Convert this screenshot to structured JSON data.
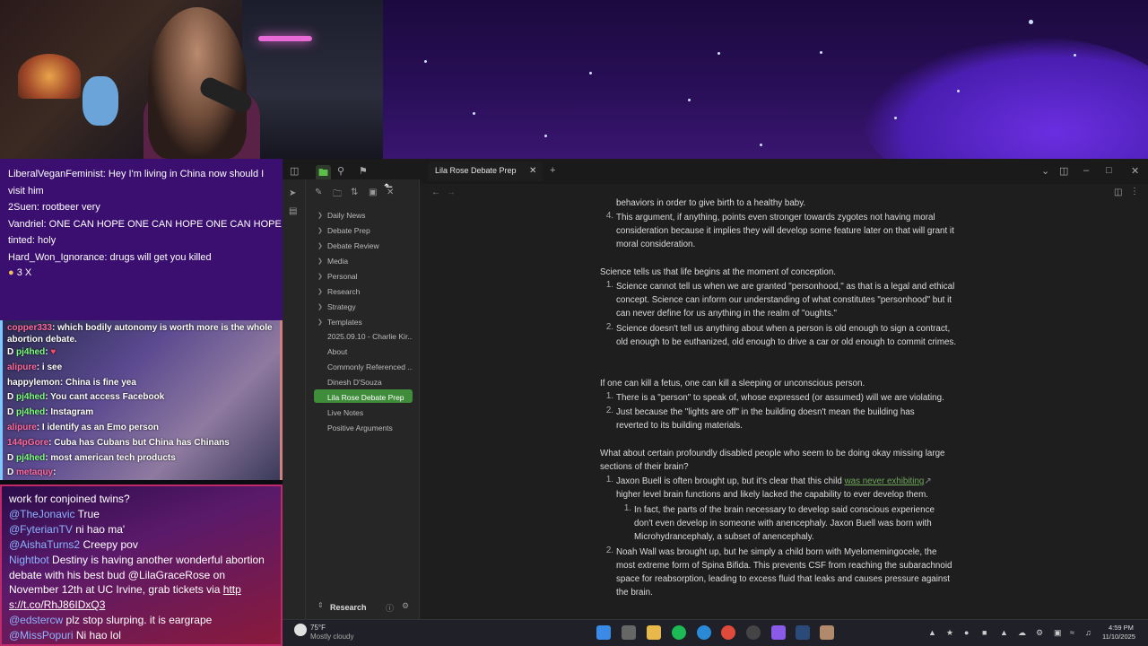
{
  "stream": {
    "chat_top": [
      {
        "user": "LiberalVeganFeminist",
        "text": "Hey I'm living in China now should I visit him"
      },
      {
        "user": "2Suen",
        "text": "rootbeer very"
      },
      {
        "user": "Vandriel",
        "text": "ONE CAN HOPE ONE CAN HOPE ONE CAN HOPE"
      },
      {
        "user": "tinted",
        "text": "holy"
      },
      {
        "user": "Hard_Won_Ignorance",
        "text": "drugs will get you killed"
      }
    ],
    "chat_top_badge": "3 X",
    "chat_mid": [
      {
        "user": "copper333",
        "text": "which bodily autonomy is worth more is the whole abortion debate."
      },
      {
        "user": "pj4hed",
        "text": ""
      },
      {
        "user": "alipure",
        "text": "i see"
      },
      {
        "user": "happylemon",
        "text": "China is fine yea"
      },
      {
        "user": "pj4hed",
        "text": "You cant access Facebook"
      },
      {
        "user": "pj4hed",
        "text": "Instagram"
      },
      {
        "user": "alipure",
        "text": "I identify as an Emo person"
      },
      {
        "user": "144pGore",
        "text": "Cuba has Cubans but China has Chinans"
      },
      {
        "user": "pj4hed",
        "text": "most american tech products"
      },
      {
        "user": "metaquy",
        "text": ""
      }
    ],
    "chat_bottom": [
      {
        "user": "",
        "text": "work for conjoined twins?"
      },
      {
        "user": "@TheJonavic",
        "text": "True"
      },
      {
        "user": "@FyterianTV",
        "text": "ni hao ma'"
      },
      {
        "user": "@AishaTurns2",
        "text": "Creepy pov"
      },
      {
        "user": "Nightbot",
        "text": "Destiny is having another wonderful abortion debate with his best bud @LilaGraceRose on November 12th at UC Irvine, grab tickets via"
      },
      {
        "user": "",
        "text": "http s://t.co/RhJ86IDxQ3"
      },
      {
        "user": "@edstercw",
        "text": "plz stop slurping. it is eargrape"
      },
      {
        "user": "@MissPopuri",
        "text": "Ni hao lol"
      }
    ]
  },
  "obsidian": {
    "tab_title": "Lila Rose Debate Prep",
    "vault_name": "Research",
    "folders": [
      "Daily News",
      "Debate Prep",
      "Debate Review",
      "Media",
      "Personal",
      "Research",
      "Strategy",
      "Templates"
    ],
    "files": [
      "2025.09.10 - Charlie Kir...",
      "About",
      "Commonly Referenced ...",
      "Dinesh D'Souza",
      "Lila Rose Debate Prep",
      "Live Notes",
      "Positive Arguments"
    ],
    "note": {
      "cut_top": "behaviors in order to give birth to a healthy baby.",
      "item4": "This argument, if anything, points even stronger towards zygotes not having moral consideration because it implies they will develop some feature later on that will grant it moral consideration.",
      "h1": "Science tells us that life begins at the moment of conception.",
      "h1_items": [
        "Science cannot tell us when we are granted \"personhood,\" as that is a legal and ethical concept. Science can inform our understanding of what constitutes \"personhood\" but it can never define for us anything in the realm of \"oughts.\"",
        "Science doesn't tell us anything about when a person is old enough to sign a contract, old enough to be euthanized, old enough to drive a car or old enough to commit crimes."
      ],
      "h2": "If one can kill a fetus, one can kill a sleeping or unconscious person.",
      "h2_items": [
        "There is a \"person\" to speak of, whose expressed (or assumed) will we are violating.",
        "Just because the \"lights are off\" in the building doesn't mean the building has reverted to its building materials."
      ],
      "h3": "What about certain profoundly disabled people who seem to be doing okay missing large sections of their brain?",
      "h3_item1_a": "Jaxon Buell is often brought up, but it's clear that this child",
      "h3_item1_link": "was never exhibiting",
      "h3_item1_b": "higher level brain functions and likely lacked the capability to ever develop them.",
      "h3_sub": "In fact, the parts of the brain necessary to develop said conscious experience don't even develop in someone with anencephaly. Jaxon Buell was born with Microhydrancephaly, a subset of anencephaly.",
      "h3_item2": "Noah Wall was brought up, but he simply a child born with Myelomemingocele, the most extreme form of Spina Bifida. This prevents CSF from reaching the subarachnoid space for reabsorption, leading to excess fluid that leaks and causes pressure against the brain."
    }
  },
  "taskbar": {
    "weather_temp": "75°F",
    "weather_desc": "Mostly cloudy",
    "time": "4:59 PM",
    "date": "11/10/2025"
  }
}
